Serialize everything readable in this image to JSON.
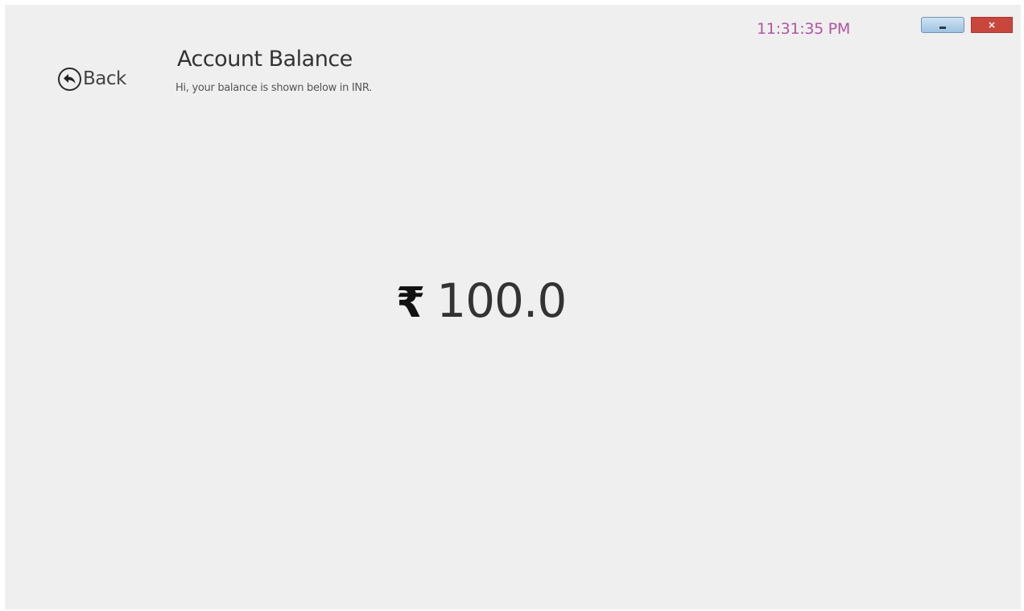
{
  "header": {
    "time": "11:31:35 PM",
    "back_label": "Back",
    "title": "Account Balance",
    "subtitle": "Hi, your balance is shown below in INR."
  },
  "window_controls": {
    "minimize_glyph": "_",
    "close_glyph": "×"
  },
  "balance": {
    "currency_symbol": "₹",
    "amount": "100.0"
  },
  "icons": {
    "back": "back-arrow-circle-icon"
  },
  "colors": {
    "background": "#efefef",
    "clock": "#b0569e",
    "close_button": "#c9463d",
    "minimize_button": "#9ec3e2"
  }
}
